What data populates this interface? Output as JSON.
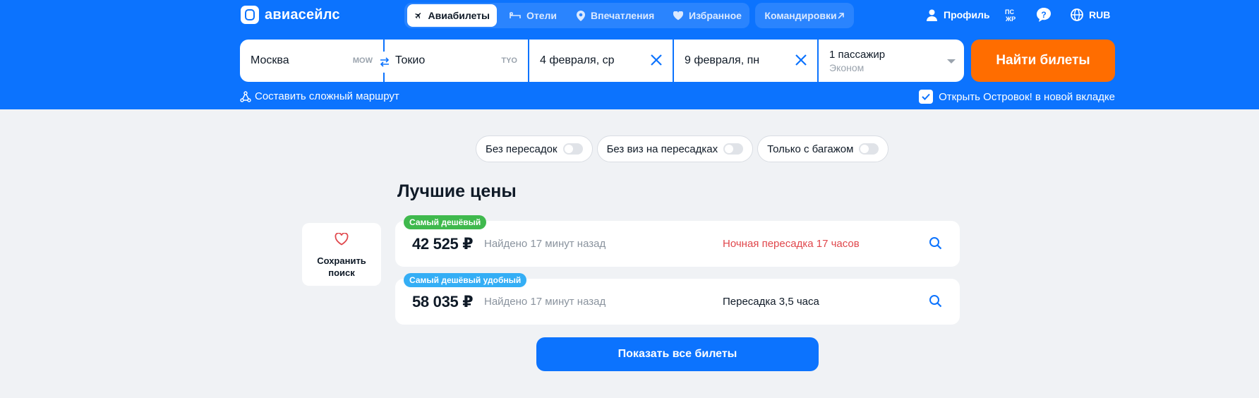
{
  "brand": {
    "name": "авиасейлс"
  },
  "nav": {
    "tabs": [
      {
        "label": "Авиабилеты",
        "icon": "plane-icon",
        "active": true
      },
      {
        "label": "Отели",
        "icon": "bed-icon",
        "active": false
      },
      {
        "label": "Впечатления",
        "icon": "location-pin-icon",
        "active": false
      },
      {
        "label": "Избранное",
        "icon": "heart-icon",
        "active": false
      }
    ],
    "business_trips": "Командировки"
  },
  "header_right": {
    "profile": "Профиль",
    "currency": "RUB"
  },
  "search": {
    "origin": {
      "city": "Москва",
      "code": "MOW"
    },
    "destination": {
      "city": "Токио",
      "code": "TYO"
    },
    "depart_date": "4 февраля, ср",
    "return_date": "9 февраля, пн",
    "passengers": "1 пассажир",
    "cabin_class": "Эконом",
    "submit": "Найти билеты"
  },
  "options": {
    "complex_route": "Составить сложный маршрут",
    "ostrovok": "Открыть Островок! в новой вкладке",
    "ostrovok_checked": true
  },
  "filters": [
    {
      "label": "Без пересадок",
      "on": false
    },
    {
      "label": "Без виз на пересадках",
      "on": false
    },
    {
      "label": "Только с багажом",
      "on": false
    }
  ],
  "best_prices": {
    "title": "Лучшие цены",
    "offers": [
      {
        "badge": "Самый дешёвый",
        "badge_color": "#3fb94d",
        "price": "42 525 ₽",
        "found": "Найдено 17 минут назад",
        "transfer": "Ночная пересадка 17 часов",
        "transfer_color": "#e0474c"
      },
      {
        "badge": "Самый дешёвый удобный",
        "badge_color": "#34aef5",
        "price": "58 035 ₽",
        "found": "Найдено 17 минут назад",
        "transfer": "Пересадка 3,5 часа",
        "transfer_color": "#0f1a27"
      }
    ]
  },
  "save_search": {
    "label": "Сохранить поиск"
  },
  "show_all": "Показать все билеты",
  "colors": {
    "accent": "#0c73fe",
    "cta": "#ff6d00",
    "page_bg": "#f0f2f5"
  }
}
